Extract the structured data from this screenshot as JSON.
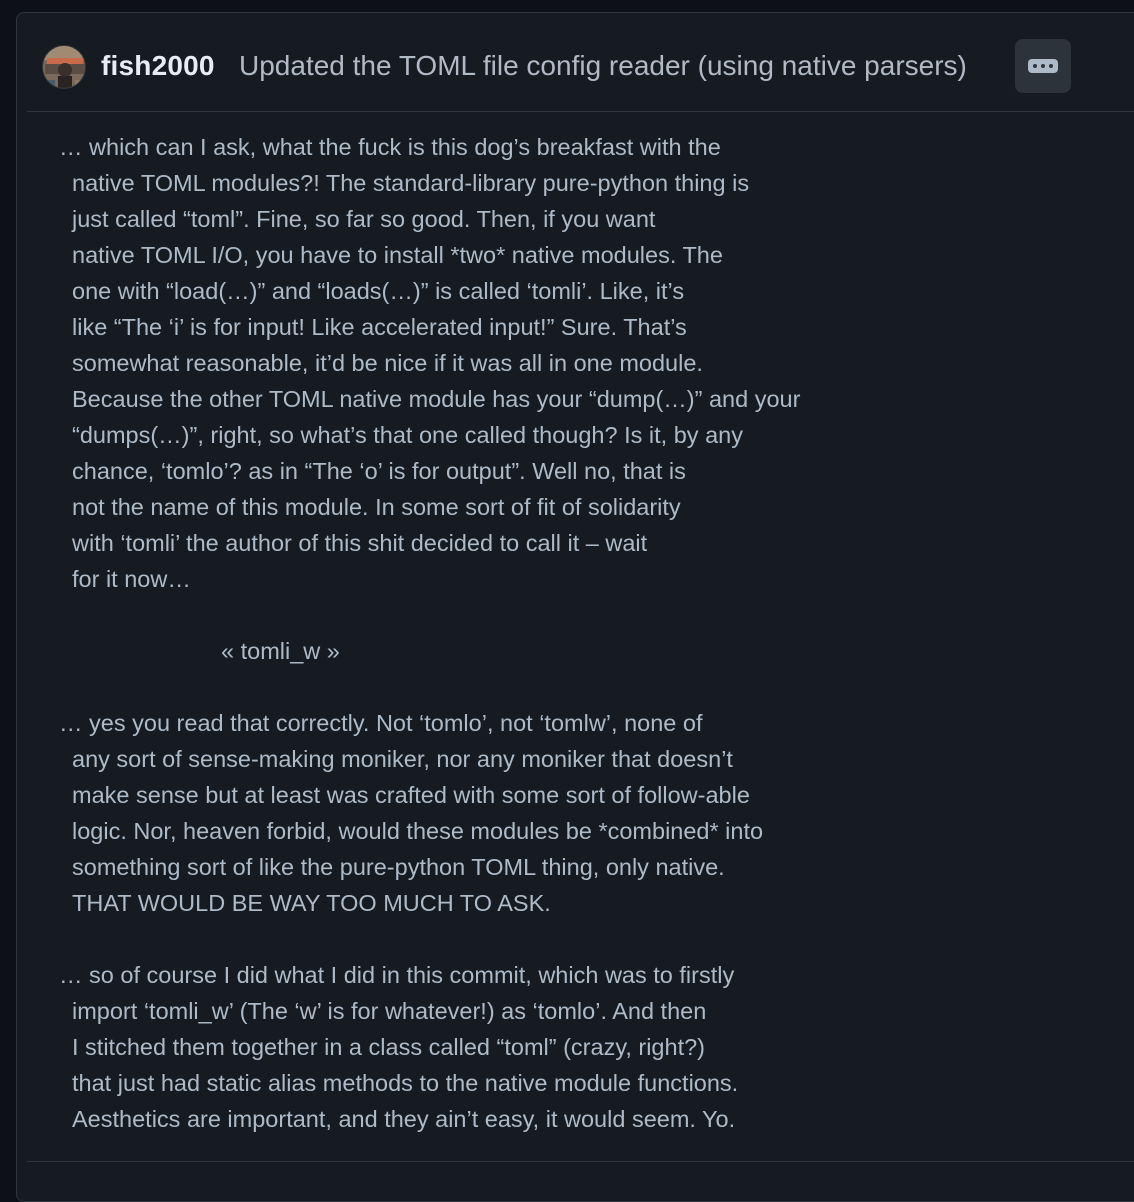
{
  "commit": {
    "author": "fish2000",
    "title": "Updated the TOML file config reader (using native parsers)",
    "more_button_icon": "kebab-horizontal-icon",
    "accent_bg": "#161b22",
    "paragraphs": [
      [
        "… which can I ask, what the fuck is this dog’s breakfast with the",
        "native TOML modules?! The standard-library pure-python thing is",
        "just called “toml”. Fine, so far so good. Then, if you want",
        "native TOML I/O, you have to install *two* native modules. The",
        "one with “load(…)” and “loads(…)” is called ‘tomli’. Like, it’s",
        "like “The ‘i’ is for input! Like accelerated input!” Sure. That’s",
        "somewhat reasonable, it’d be nice if it was all in one module.",
        "Because the other TOML native module has your “dump(…)” and your",
        "“dumps(…)”, right, so what’s that one called though? Is it, by any",
        "chance, ‘tomlo’? as in “The ‘o’ is for output”. Well no, that is",
        "not the name of this module. In some sort of fit of solidarity",
        "with ‘tomli’ the author of this shit decided to call it – wait",
        "for it now…"
      ],
      [
        "« tomli_w »"
      ],
      [
        "… yes you read that correctly. Not ‘tomlo’, not ‘tomlw’, none of",
        "any sort of sense-making moniker, nor any moniker that doesn’t",
        "make sense but at least was crafted with some sort of follow-able",
        "logic. Nor, heaven forbid, would these modules be *combined* into",
        "something sort of like the pure-python TOML thing, only native.",
        "THAT WOULD BE WAY TOO MUCH TO ASK."
      ],
      [
        "… so of course I did what I did in this commit, which was to firstly",
        "import ‘tomli_w’ (The ‘w’ is for whatever!) as ‘tomlo’. And then",
        "I stitched them together in a class called “toml” (crazy, right?)",
        "that just had static alias methods to the native module functions.",
        "Aesthetics are important, and they ain’t easy, it would seem. Yo."
      ]
    ]
  }
}
